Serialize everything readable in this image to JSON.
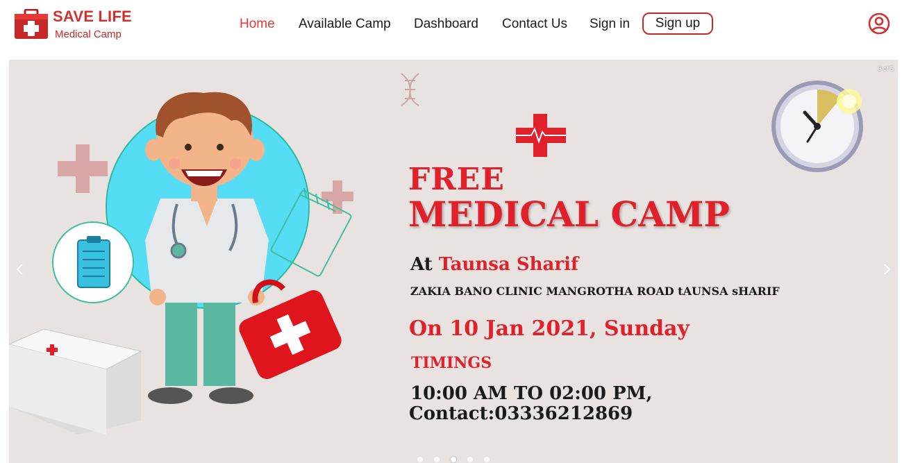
{
  "brand": {
    "title": "SAVE LIFE",
    "subtitle": "Medical Camp",
    "color": "#d32f2f"
  },
  "nav": {
    "items": [
      {
        "label": "Home",
        "active": true
      },
      {
        "label": "Available Camp",
        "active": false
      },
      {
        "label": "Dashboard",
        "active": false
      },
      {
        "label": "Contact Us",
        "active": false
      },
      {
        "label": "Sign in",
        "active": false
      }
    ],
    "signup_label": "Sign up",
    "user_icon": "user-circle-icon",
    "active_color": "#e53935"
  },
  "carousel": {
    "counter": "3 of 5",
    "prev_icon": "chevron-left-icon",
    "next_icon": "chevron-right-icon",
    "total_slides": 5,
    "current_slide": 3,
    "background": "#e8e3e1"
  },
  "poster": {
    "line1": "FREE",
    "line2": "MEDICAL CAMP",
    "at_label": "At",
    "location": "Taunsa Sharif",
    "address": "ZAKIA BANO CLINIC MANGROTHA ROAD tAUNSA sHARIF",
    "date": "On 10 Jan 2021, Sunday",
    "timings_label": "TIMINGS",
    "time": "10:00 AM TO 02:00 PM,",
    "contact": "Contact:03336212869",
    "accent": "#e0202a"
  }
}
